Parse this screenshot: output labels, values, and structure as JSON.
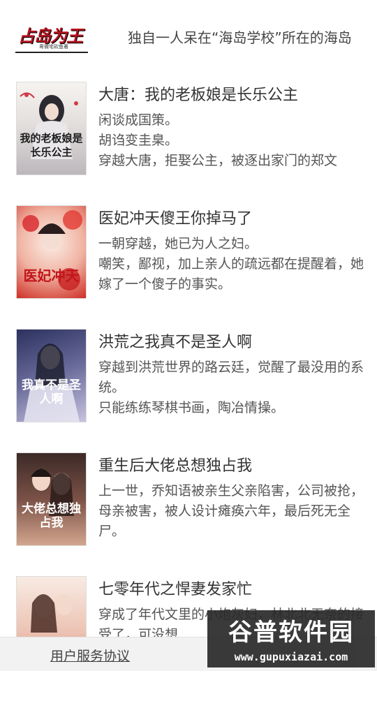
{
  "top_item": {
    "cover_title": "占岛为王",
    "cover_author": "卑微宅砍鱼著",
    "description": "独自一人呆在“海岛学校”所在的海岛"
  },
  "books": [
    {
      "title": "大唐：我的老板娘是长乐公主",
      "description": [
        "闲谈成国策。",
        "胡诌变圭臬。",
        "穿越大唐，拒娶公主，被逐出家门的郑文"
      ],
      "cover_text": "我的老板娘是长乐公主",
      "cover_colors": [
        "#f4f1ee",
        "#c9c6c8"
      ]
    },
    {
      "title": "医妃冲天傻王你掉马了",
      "description": [
        "一朝穿越，她已为人之妇。",
        "嘲笑，鄙视，加上亲人的疏远都在提醒着，她嫁了一个傻子的事实。"
      ],
      "cover_text": "医妃冲天",
      "cover_colors": [
        "#f3d1c4",
        "#d5362a"
      ]
    },
    {
      "title": "洪荒之我真不是圣人啊",
      "description": [
        "穿越到洪荒世界的路云廷，觉醒了最没用的系统。",
        "只能练练琴棋书画，陶冶情操。"
      ],
      "cover_text": "我真不是圣人啊",
      "cover_colors": [
        "#3b3f6e",
        "#b9b3d6"
      ]
    },
    {
      "title": "重生后大佬总想独占我",
      "description": [
        "上一世，乔知语被亲生父亲陷害，公司被抢，母亲被害，被人设计瘫痪六年，最后死无全尸。"
      ],
      "cover_text": "大佬总想独占我",
      "cover_colors": [
        "#5a3b34",
        "#c99a86"
      ]
    },
    {
      "title": "七零年代之悍妻发家忙",
      "description": [
        "穿成了年代文里的小炮灰妇，林北北无奈的接受了，可没想……"
      ],
      "cover_text": "悍妻",
      "cover_colors": [
        "#f4dccf",
        "#c97063"
      ]
    }
  ],
  "footer": {
    "agreement_link": "用户服务协议"
  },
  "watermark": {
    "name": "谷普软件园",
    "url": "www.gupuxiazai.com"
  }
}
